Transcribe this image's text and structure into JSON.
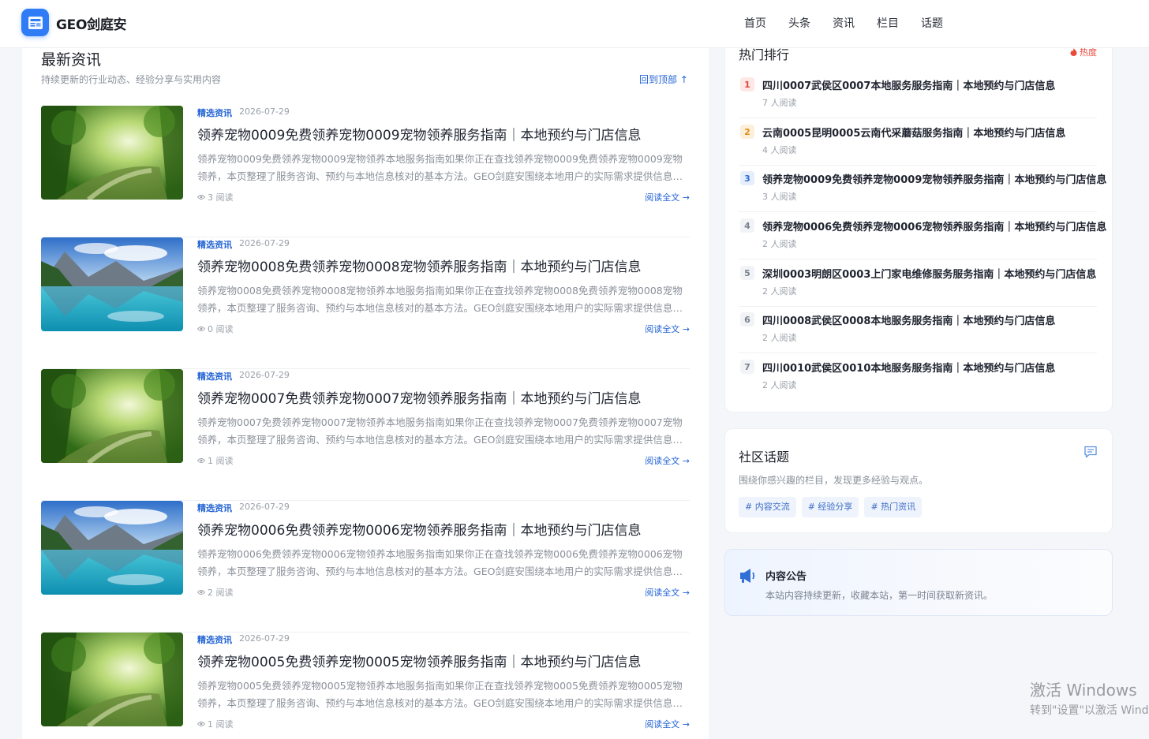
{
  "header": {
    "site_name": "GEO剑庭安",
    "logo_icon": "newspaper-icon",
    "accent_color": "#2f7cf6",
    "nav": [
      "首页",
      "头条",
      "资讯",
      "栏目",
      "话题"
    ]
  },
  "main": {
    "title": "最新资讯",
    "subtitle": "持续更新的行业动态、经验分享与实用内容",
    "back_to_top": "回到顶部 ↑",
    "articles": [
      {
        "tag": "精选资讯",
        "date": "2026-07-29",
        "title": "领养宠物0009免费领养宠物0009宠物领养服务指南｜本地预约与门店信息",
        "desc": "领养宠物0009免费领养宠物0009宠物领养本地服务指南如果你正在查找领养宠物0009免费领养宠物0009宠物领养，本页整理了服务咨询、预约与本地信息核对的基本方法。GEO剑庭安围绕本地用户的实际需求提供信息参考。",
        "views": "3 阅读",
        "more": "阅读全文 →",
        "image": "forest-path"
      },
      {
        "tag": "精选资讯",
        "date": "2026-07-29",
        "title": "领养宠物0008免费领养宠物0008宠物领养服务指南｜本地预约与门店信息",
        "desc": "领养宠物0008免费领养宠物0008宠物领养本地服务指南如果你正在查找领养宠物0008免费领养宠物0008宠物领养，本页整理了服务咨询、预约与本地信息核对的基本方法。GEO剑庭安围绕本地用户的实际需求提供信息参考。",
        "views": "0 阅读",
        "more": "阅读全文 →",
        "image": "mountain-lake"
      },
      {
        "tag": "精选资讯",
        "date": "2026-07-29",
        "title": "领养宠物0007免费领养宠物0007宠物领养服务指南｜本地预约与门店信息",
        "desc": "领养宠物0007免费领养宠物0007宠物领养本地服务指南如果你正在查找领养宠物0007免费领养宠物0007宠物领养，本页整理了服务咨询、预约与本地信息核对的基本方法。GEO剑庭安围绕本地用户的实际需求提供信息参考。",
        "views": "1 阅读",
        "more": "阅读全文 →",
        "image": "forest-path"
      },
      {
        "tag": "精选资讯",
        "date": "2026-07-29",
        "title": "领养宠物0006免费领养宠物0006宠物领养服务指南｜本地预约与门店信息",
        "desc": "领养宠物0006免费领养宠物0006宠物领养本地服务指南如果你正在查找领养宠物0006免费领养宠物0006宠物领养，本页整理了服务咨询、预约与本地信息核对的基本方法。GEO剑庭安围绕本地用户的实际需求提供信息参考。",
        "views": "2 阅读",
        "more": "阅读全文 →",
        "image": "mountain-lake"
      },
      {
        "tag": "精选资讯",
        "date": "2026-07-29",
        "title": "领养宠物0005免费领养宠物0005宠物领养服务指南｜本地预约与门店信息",
        "desc": "领养宠物0005免费领养宠物0005宠物领养本地服务指南如果你正在查找领养宠物0005免费领养宠物0005宠物领养，本页整理了服务咨询、预约与本地信息核对的基本方法。GEO剑庭安围绕本地用户的实际需求提供信息参考。",
        "views": "1 阅读",
        "more": "阅读全文 →",
        "image": "forest-path"
      }
    ]
  },
  "hot": {
    "title": "热门排行",
    "badge": "热度",
    "badge_color": "#e84b3c",
    "items": [
      {
        "rank": "1",
        "title": "四川0007武侯区0007本地服务服务指南｜本地预约与门店信息",
        "views": "7 人阅读"
      },
      {
        "rank": "2",
        "title": "云南0005昆明0005云南代采蘑菇服务指南｜本地预约与门店信息",
        "views": "4 人阅读"
      },
      {
        "rank": "3",
        "title": "领养宠物0009免费领养宠物0009宠物领养服务指南｜本地预约与门店信息",
        "views": "3 人阅读"
      },
      {
        "rank": "4",
        "title": "领养宠物0006免费领养宠物0006宠物领养服务指南｜本地预约与门店信息",
        "views": "2 人阅读"
      },
      {
        "rank": "5",
        "title": "深圳0003明朗区0003上门家电维修服务服务指南｜本地预约与门店信息",
        "views": "2 人阅读"
      },
      {
        "rank": "6",
        "title": "四川0008武侯区0008本地服务服务指南｜本地预约与门店信息",
        "views": "2 人阅读"
      },
      {
        "rank": "7",
        "title": "四川0010武侯区0010本地服务服务指南｜本地预约与门店信息",
        "views": "2 人阅读"
      }
    ]
  },
  "topics": {
    "title": "社区话题",
    "icon": "chat-icon",
    "desc": "围绕你感兴趣的栏目，发现更多经验与观点。",
    "tags": [
      "# 内容交流",
      "# 经验分享",
      "# 热门资讯"
    ]
  },
  "notice": {
    "icon": "megaphone-icon",
    "title": "内容公告",
    "text": "本站内容持续更新，收藏本站，第一时间获取新资讯。"
  },
  "watermark": {
    "line1": "激活 Windows",
    "line2": "转到\"设置\"以激活 Windows。"
  }
}
